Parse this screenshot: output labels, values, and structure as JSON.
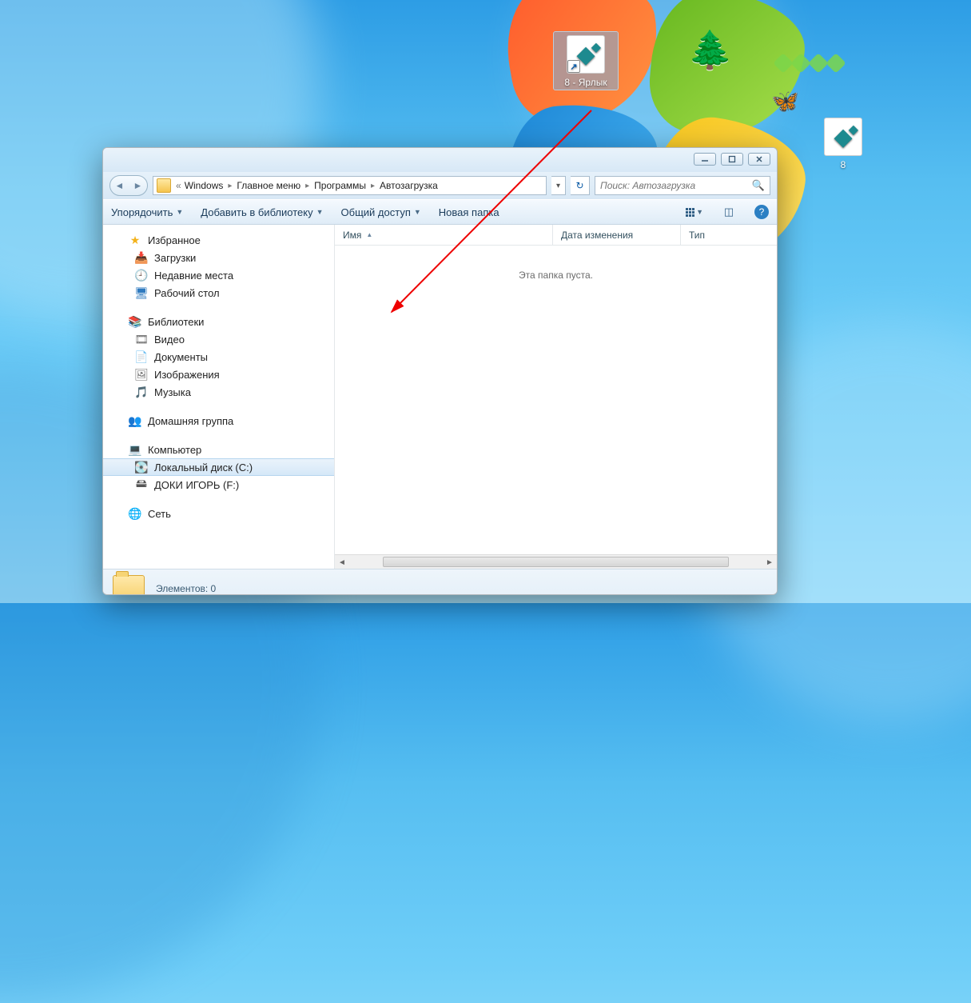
{
  "desktop": {
    "icons": [
      {
        "label": "8 - Ярлык",
        "selected": true,
        "shortcut": true
      },
      {
        "label": "8",
        "selected": false,
        "shortcut": false
      }
    ]
  },
  "window": {
    "controls": {
      "minimize": "–",
      "maximize": "▭",
      "close": "✕"
    },
    "breadcrumb": {
      "prefix": "«",
      "items": [
        "Windows",
        "Главное меню",
        "Программы",
        "Автозагрузка"
      ]
    },
    "search": {
      "placeholder": "Поиск: Автозагрузка"
    },
    "toolbar": {
      "organize": "Упорядочить",
      "addlib": "Добавить в библиотеку",
      "share": "Общий доступ",
      "newfolder": "Новая папка"
    },
    "columns": {
      "name": "Имя",
      "date": "Дата изменения",
      "type": "Тип"
    },
    "empty_text": "Эта папка пуста.",
    "status": {
      "elements_label": "Элементов:",
      "elements_count": "0"
    },
    "nav": {
      "favorites": {
        "label": "Избранное",
        "items": [
          "Загрузки",
          "Недавние места",
          "Рабочий стол"
        ]
      },
      "libraries": {
        "label": "Библиотеки",
        "items": [
          "Видео",
          "Документы",
          "Изображения",
          "Музыка"
        ]
      },
      "homegroup": {
        "label": "Домашняя группа"
      },
      "computer": {
        "label": "Компьютер",
        "items": [
          "Локальный диск (C:)",
          "ДОКИ ИГОРЬ (F:)"
        ],
        "selected_index": 0
      },
      "network": {
        "label": "Сеть"
      }
    }
  }
}
